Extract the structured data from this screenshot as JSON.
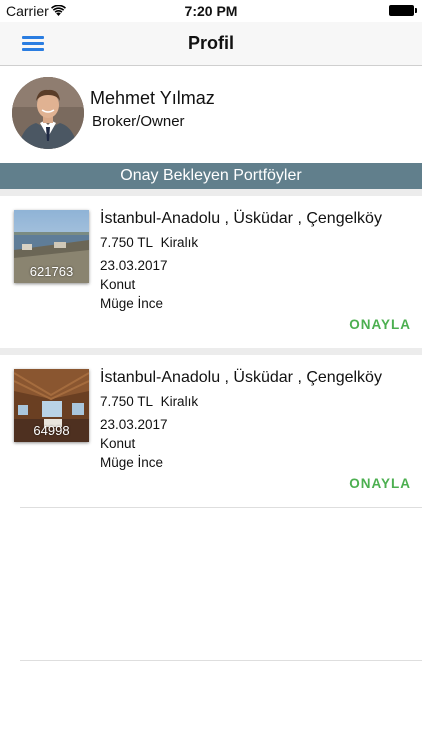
{
  "status_bar": {
    "carrier": "Carrier",
    "time": "7:20 PM"
  },
  "nav": {
    "title": "Profil",
    "menu_icon": "hamburger-menu-icon"
  },
  "profile": {
    "name": "Mehmet Yılmaz",
    "role": "Broker/Owner"
  },
  "section": {
    "title": "Onay Bekleyen Portföyler"
  },
  "portfolios": [
    {
      "id": "621763",
      "location": "İstanbul-Anadolu , Üsküdar , Çengelköy",
      "price": "7.750 TL",
      "listing_type": "Kiralık",
      "date": "23.03.2017",
      "category": "Konut",
      "agent": "Müge İnce",
      "action": "ONAYLA"
    },
    {
      "id": "64998",
      "location": "İstanbul-Anadolu , Üsküdar , Çengelköy",
      "price": "7.750 TL",
      "listing_type": "Kiralık",
      "date": "23.03.2017",
      "category": "Konut",
      "agent": "Müge İnce",
      "action": "ONAYLA"
    }
  ],
  "colors": {
    "accent": "#2a7de1",
    "section_bg": "#617f8c",
    "approve": "#4caf50"
  }
}
